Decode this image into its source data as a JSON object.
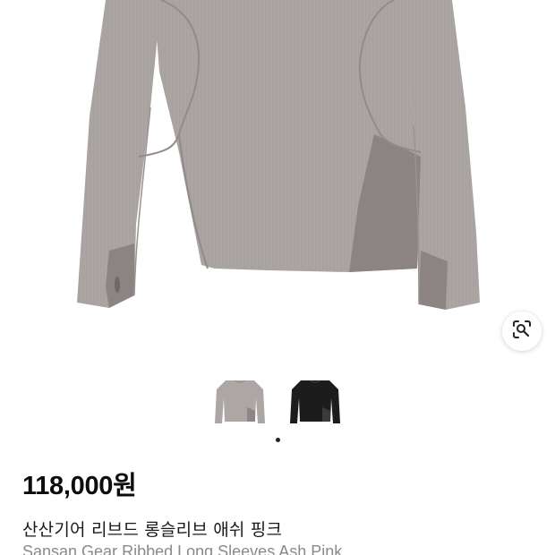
{
  "product": {
    "price": "118,000원",
    "title_ko": "산산기어 리브드 롱슬리브 애쉬 핑크",
    "title_en": "Sansan Gear Ribbed Long Sleeves Ash Pink"
  },
  "image_viewer": {
    "lens_icon": "image-search-lens-icon",
    "variants": [
      {
        "color_name": "ash pink",
        "swatch": "#aca6a4",
        "panel": "#8e8684"
      },
      {
        "color_name": "black",
        "swatch": "#1c1c1c",
        "panel": "#2a2a2a"
      }
    ],
    "dot_count": 1,
    "active_dot": 0
  },
  "colors": {
    "garment_body": "#aaa4a2",
    "garment_panel": "#8c8482",
    "seam": "#938b89"
  }
}
